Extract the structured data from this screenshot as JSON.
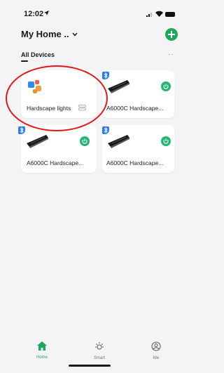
{
  "status": {
    "time": "12:02"
  },
  "header": {
    "home_title": "My Home .."
  },
  "tabs": {
    "all_devices": "All Devices",
    "more": "··"
  },
  "devices": [
    {
      "name": "Hardscape lights",
      "type": "group"
    },
    {
      "name": "A6000C Hardscape...",
      "type": "lamp",
      "power": "on"
    },
    {
      "name": "A6000C Hardscape...",
      "type": "lamp",
      "power": "on"
    },
    {
      "name": "A6000C Hardscape...",
      "type": "lamp",
      "power": "on"
    }
  ],
  "tabbar": {
    "home": "Home",
    "smart": "Smart",
    "me": "Me"
  },
  "colors": {
    "accent": "#1fa85a",
    "power_on": "#22b573",
    "bluetooth": "#2b7de9",
    "annotation": "#e01818"
  }
}
